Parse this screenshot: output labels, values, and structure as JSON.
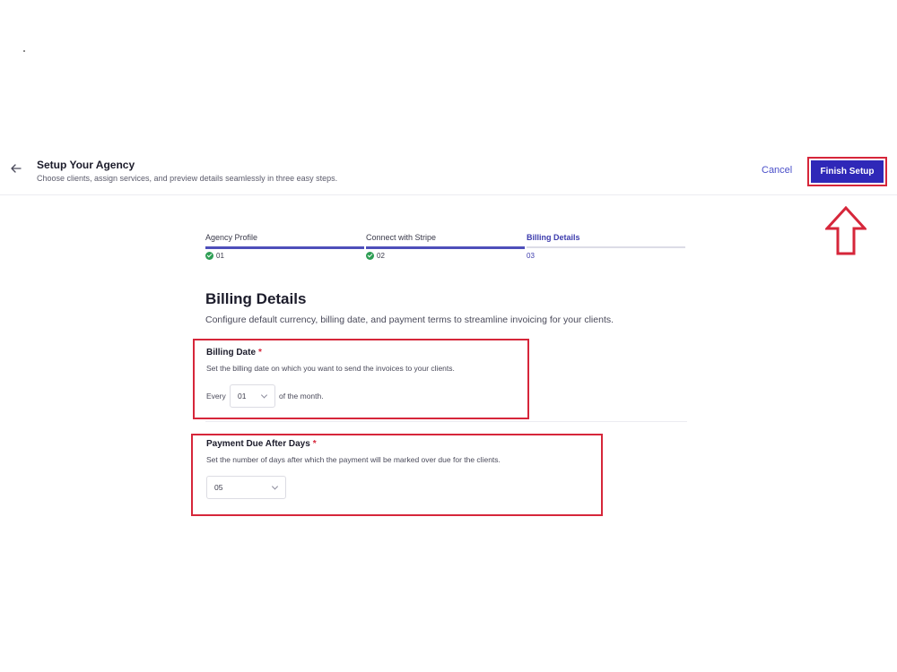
{
  "header": {
    "title": "Setup Your Agency",
    "subtitle": "Choose clients, assign services, and preview details seamlessly in three easy steps.",
    "cancel_label": "Cancel",
    "finish_label": "Finish Setup"
  },
  "steps": [
    {
      "label": "Agency Profile",
      "number": "01",
      "status": "complete"
    },
    {
      "label": "Connect with Stripe",
      "number": "02",
      "status": "complete"
    },
    {
      "label": "Billing Details",
      "number": "03",
      "status": "active"
    }
  ],
  "section": {
    "title": "Billing Details",
    "description": "Configure default currency, billing date, and payment terms to streamline invoicing for your clients."
  },
  "billing_date": {
    "label": "Billing Date",
    "required_mark": "*",
    "help": "Set the billing date on which you want to send the invoices to your clients.",
    "prefix": "Every",
    "value": "01",
    "suffix": "of the month."
  },
  "payment_due": {
    "label": "Payment Due After Days",
    "required_mark": "*",
    "help": "Set the number of days after which the payment will be marked over due for the clients.",
    "value": "05"
  },
  "colors": {
    "primary": "#2f28b8",
    "highlight": "#d6263a",
    "success": "#2e9e54"
  },
  "icons": [
    "arrow-left-icon",
    "check-circle-icon",
    "chevron-down-icon",
    "up-arrow-annotation-icon"
  ]
}
